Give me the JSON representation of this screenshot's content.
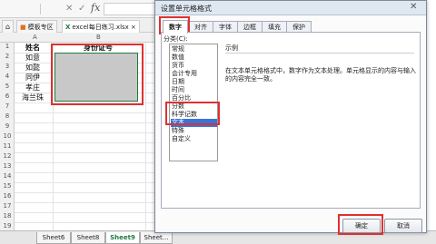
{
  "formula_bar": {
    "check_mark": "✓",
    "fx_label": "fx"
  },
  "workbook_tabs": {
    "template_tab": "模板专区",
    "file_tab": "excel每日练习.xlsx",
    "file_close": "×"
  },
  "spreadsheet": {
    "columns": [
      "A",
      "B"
    ],
    "rows": [
      "1",
      "2",
      "3",
      "4",
      "5",
      "6",
      "7",
      "8",
      "9",
      "10",
      "11",
      "12",
      "13",
      "14",
      "15",
      "16",
      "17",
      "18",
      "19"
    ],
    "header_a": "姓名",
    "header_b": "身份证号",
    "names": [
      "如意",
      "如懿",
      "同伊",
      "孝庄",
      "海兰珠"
    ]
  },
  "sheet_tabs": [
    "Sheet6",
    "Sheet8",
    "Sheet9",
    "Sheet..."
  ],
  "active_sheet_index": 2,
  "dialog": {
    "title": "设置单元格格式",
    "tabs": [
      "数字",
      "对齐",
      "字体",
      "边框",
      "填充",
      "保护"
    ],
    "active_tab": 0,
    "category_label": "分类(C):",
    "categories": [
      "常规",
      "数值",
      "货币",
      "会计专用",
      "日期",
      "时间",
      "百分比",
      "分数",
      "科学记数",
      "文本",
      "特殊",
      "自定义"
    ],
    "selected_category": 9,
    "sample_label": "示例",
    "description": "在文本单元格格式中，数字作为文本处理。单元格显示的内容与输入的内容完全一致。",
    "ok_label": "确定",
    "cancel_label": "取消"
  },
  "colors": {
    "selection_fill": "#c8c8c8",
    "selected_item": "#3875d7",
    "highlight_red": "#e03030",
    "active_sheet_tab": "#1e7b3d"
  }
}
